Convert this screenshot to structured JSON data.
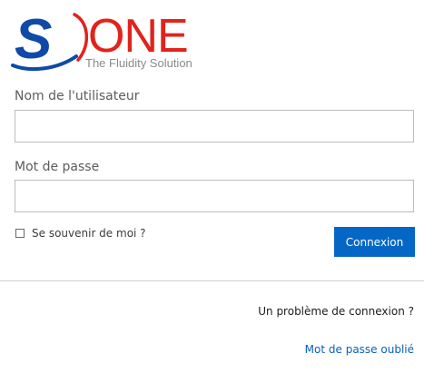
{
  "logo": {
    "mark": "S",
    "word": "ONE",
    "tagline": "The Fluidity Solution",
    "colors": {
      "blue": "#0f4aa8",
      "red": "#e0231c",
      "gray": "#8a8a8a"
    }
  },
  "form": {
    "username_label": "Nom de l'utilisateur",
    "username_value": "",
    "password_label": "Mot de passe",
    "password_value": "",
    "remember_label": "Se souvenir de moi ?",
    "remember_checked": false,
    "submit_label": "Connexion"
  },
  "help": {
    "problem_text": "Un problème de connexion ?",
    "forgot_link": "Mot de passe oublié"
  },
  "colors": {
    "primary_button": "#0567c5",
    "link": "#0a5fbf"
  }
}
